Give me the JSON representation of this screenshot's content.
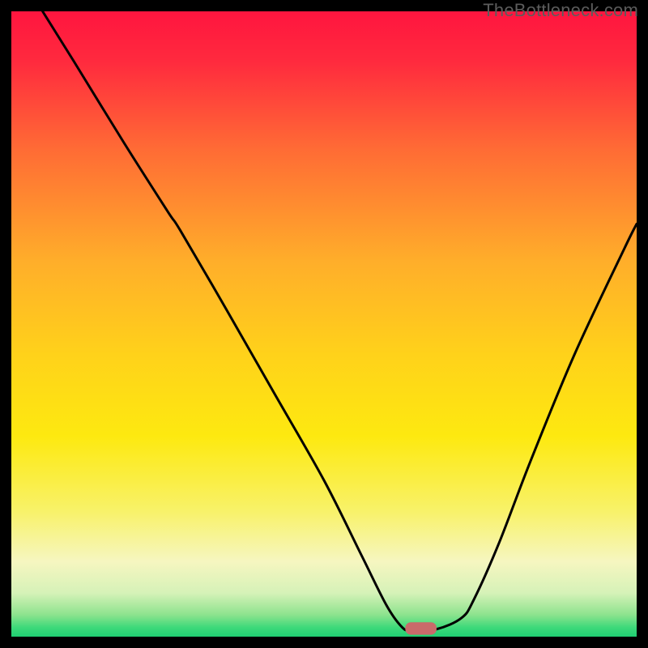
{
  "watermark": "TheBottleneck.com",
  "chart_data": {
    "type": "line",
    "title": "",
    "xlabel": "",
    "ylabel": "",
    "xlim": [
      0,
      100
    ],
    "ylim": [
      0,
      100
    ],
    "grid": false,
    "legend": false,
    "gradient_stops": [
      {
        "offset": 0.0,
        "color": "#ff153f"
      },
      {
        "offset": 0.08,
        "color": "#ff2a3e"
      },
      {
        "offset": 0.22,
        "color": "#ff6b35"
      },
      {
        "offset": 0.4,
        "color": "#ffae2a"
      },
      {
        "offset": 0.55,
        "color": "#ffd21a"
      },
      {
        "offset": 0.68,
        "color": "#fde910"
      },
      {
        "offset": 0.8,
        "color": "#f8f26a"
      },
      {
        "offset": 0.88,
        "color": "#f6f6c0"
      },
      {
        "offset": 0.93,
        "color": "#d6f2b8"
      },
      {
        "offset": 0.965,
        "color": "#8de38e"
      },
      {
        "offset": 0.985,
        "color": "#3ed97a"
      },
      {
        "offset": 1.0,
        "color": "#1fcf72"
      }
    ],
    "series": [
      {
        "name": "bottleneck-curve",
        "x": [
          5,
          10,
          18,
          25,
          27,
          34,
          42,
          50,
          56,
          60,
          62.5,
          64,
          68,
          72,
          74,
          78,
          83,
          90,
          98,
          100
        ],
        "y": [
          100,
          92,
          79,
          68,
          65,
          53,
          39,
          25,
          13,
          5,
          1.5,
          1,
          1.2,
          3,
          6,
          15,
          28,
          45,
          62,
          66
        ]
      }
    ],
    "marker": {
      "name": "optimal-point",
      "x": 65.5,
      "y": 1.3,
      "width": 5.0,
      "height": 2.0,
      "color": "#c96a6a"
    }
  }
}
